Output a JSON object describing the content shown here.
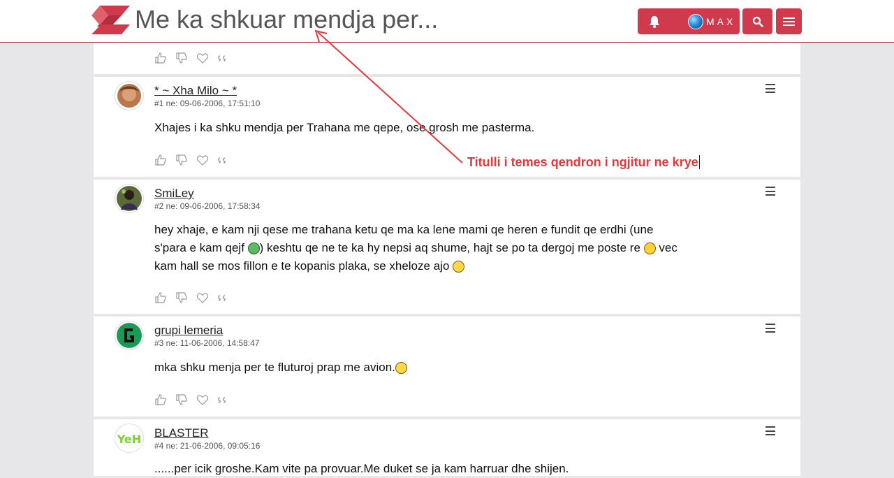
{
  "header": {
    "title": "Me ka shkuar mendja per...",
    "user_label": "MAX",
    "colors": {
      "accent": "#d03a4c",
      "logo": "#d03a4c"
    }
  },
  "posts": [
    {
      "author": "* ~ Xha Milo ~ *",
      "meta": "#1 ne: 09-06-2006, 17:51:10",
      "text": "Xhajes i ka shku mendja per Trahana me qepe, ose grosh me pasterma."
    },
    {
      "author": "SmiLey",
      "meta": "#2 ne: 09-06-2006, 17:58:34",
      "text_line1": "hey xhaje, e kam nji qese me trahana ketu qe ma ka lene mami qe heren e fundit qe erdhi (une",
      "text_line2a": "s'para e kam qejf ",
      "text_line2b": ") keshtu qe ne te ka hy nepsi aq shume, hajt se po ta dergoj me poste re ",
      "text_line2c": " vec",
      "text_line3": "kam hall se mos fillon e te kopanis plaka, se xheloze ajo "
    },
    {
      "author": "grupi lemeria",
      "meta": "#3 ne: 11-06-2006, 14:58:47",
      "text": "mka shku menja per te fluturoj prap me avion."
    },
    {
      "author": "BLASTER",
      "meta": "#4 ne: 21-06-2006, 09:05:16",
      "text": "......per icik groshe.Kam vite pa provuar.Me duket se ja kam harruar dhe shijen."
    }
  ],
  "annotation": {
    "text": "Titulli i temes qendron i ngjitur ne krye",
    "color": "#e23a3a"
  }
}
